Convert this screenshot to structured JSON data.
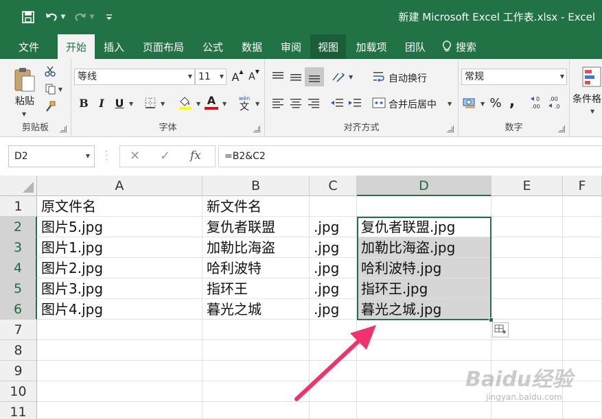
{
  "window": {
    "title": "新建 Microsoft Excel 工作表.xlsx  -  Excel"
  },
  "qat": {
    "icons": [
      "save-icon",
      "undo-icon",
      "redo-icon",
      "customize-qat-icon"
    ]
  },
  "tabs": [
    {
      "label": "文件"
    },
    {
      "label": "开始"
    },
    {
      "label": "插入"
    },
    {
      "label": "页面布局"
    },
    {
      "label": "公式"
    },
    {
      "label": "数据"
    },
    {
      "label": "审阅"
    },
    {
      "label": "视图"
    },
    {
      "label": "加载项"
    },
    {
      "label": "团队"
    },
    {
      "label": "搜索"
    }
  ],
  "ribbon": {
    "clipboard": {
      "label": "剪贴板",
      "paste_label": "粘贴"
    },
    "font": {
      "label": "字体",
      "font_name": "等线",
      "font_size": "11",
      "grow_label": "A",
      "shrink_label": "A",
      "bold_label": "B",
      "italic_label": "I",
      "underline_label": "U",
      "font_color_label": "A",
      "phonetic_label": "文"
    },
    "alignment": {
      "label": "对齐方式",
      "wrap_label": "自动换行",
      "merge_label": "合并后居中"
    },
    "number": {
      "label": "数字",
      "format": "常规",
      "percent_label": "%",
      "comma_label": ","
    },
    "styles": {
      "cond_format_label": "条件格"
    },
    "colors": {
      "font_color": "#e01010",
      "highlight_color": "#ffff00",
      "accent": "#217346"
    }
  },
  "formula_bar": {
    "name_box": "D2",
    "cancel": "✕",
    "enter": "✓",
    "fx": "fx",
    "formula": "=B2&C2"
  },
  "sheet": {
    "columns": [
      "A",
      "B",
      "C",
      "D",
      "E",
      "F"
    ],
    "rows": [
      "1",
      "2",
      "3",
      "4",
      "5",
      "6",
      "7",
      "8",
      "9",
      "10",
      "11"
    ],
    "cells": {
      "A1": "原文件名",
      "B1": "新文件名",
      "A2": "图片5.jpg",
      "B2": "复仇者联盟",
      "C2": ".jpg",
      "D2": "复仇者联盟.jpg",
      "A3": "图片1.jpg",
      "B3": "加勒比海盗",
      "C3": ".jpg",
      "D3": "加勒比海盗.jpg",
      "A4": "图片2.jpg",
      "B4": "哈利波特",
      "C4": ".jpg",
      "D4": "哈利波特.jpg",
      "A5": "图片3.jpg",
      "B5": "指环王",
      "C5": ".jpg",
      "D5": "指环王.jpg",
      "A6": "图片4.jpg",
      "B6": "暮光之城",
      "C6": ".jpg",
      "D6": "暮光之城.jpg"
    }
  },
  "watermark": {
    "text": "Baidu经验",
    "sub": "jingyan.baidu.com"
  },
  "annotation": {
    "arrow_color": "#f0326e"
  }
}
